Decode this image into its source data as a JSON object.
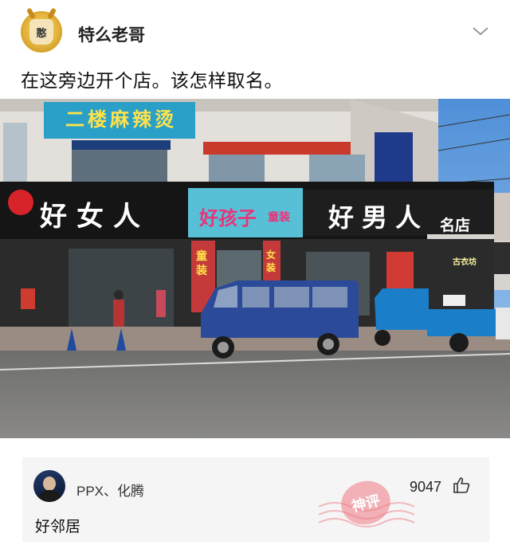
{
  "post": {
    "author": "特么老哥",
    "avatar_text": "憨",
    "text": "在这旁边开个店。该怎样取名。"
  },
  "photo": {
    "signs": {
      "top_sign": "二楼麻辣烫",
      "left_store": "好女人",
      "middle_store": "好孩子",
      "middle_store_sub": "童装",
      "right_store": "好男人",
      "right_store_suffix": "名店",
      "shop_sign": "古衣坊",
      "side_sign": "童装",
      "side_sign2": "女装"
    }
  },
  "comment": {
    "user": "PPX、化腾",
    "likes": "9047",
    "text": "好邻居",
    "stamp": "神评"
  },
  "colors": {
    "store_black": "#111111",
    "van_blue": "#2b4a99",
    "stamp_pink": "#ec7882"
  }
}
